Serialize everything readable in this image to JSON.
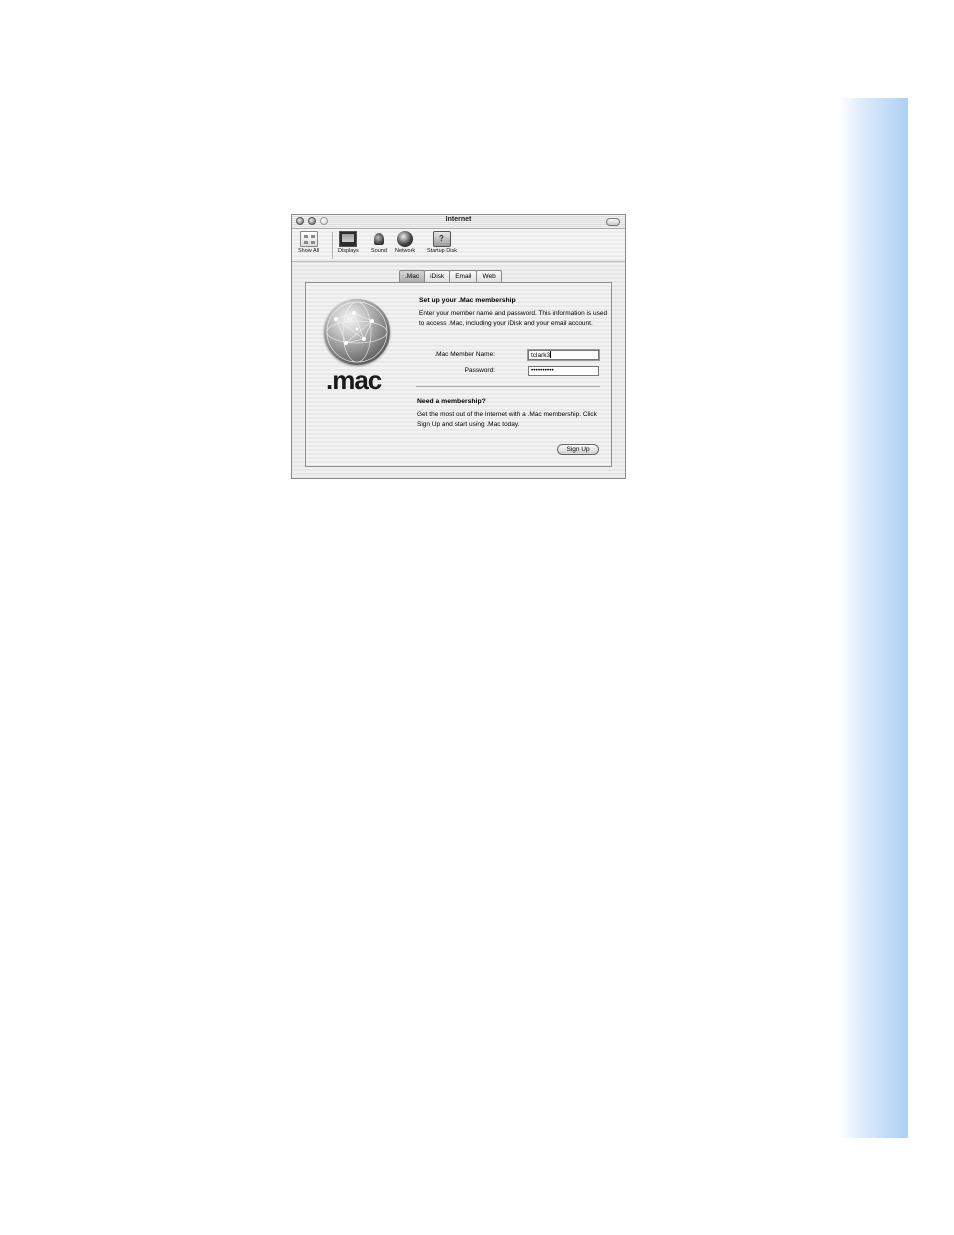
{
  "window": {
    "title": "Internet"
  },
  "toolbar": {
    "items": [
      {
        "label": "Show All",
        "icon": "apple-grid-icon"
      },
      {
        "label": "Displays",
        "icon": "display-icon"
      },
      {
        "label": "Sound",
        "icon": "speaker-icon"
      },
      {
        "label": "Network",
        "icon": "network-globe-icon"
      },
      {
        "label": "Startup Disk",
        "icon": "startup-disk-icon"
      }
    ]
  },
  "tabs": [
    {
      "label": ".Mac",
      "selected": true
    },
    {
      "label": "iDisk",
      "selected": false
    },
    {
      "label": "Email",
      "selected": false
    },
    {
      "label": "Web",
      "selected": false
    }
  ],
  "mac_panel": {
    "logo_text": ".mac",
    "setup_heading": "Set up your .Mac membership",
    "setup_description": "Enter your member name and password. This information is used to access .Mac, including your iDisk and your email account.",
    "member_name_label": ".Mac Member Name:",
    "member_name_value": "tclark3",
    "password_label": "Password:",
    "password_value": "••••••••••",
    "need_heading": "Need a membership?",
    "need_description": "Get the most out of the Internet with a .Mac membership. Click Sign Up and start using .Mac today.",
    "signup_label": "Sign Up"
  }
}
